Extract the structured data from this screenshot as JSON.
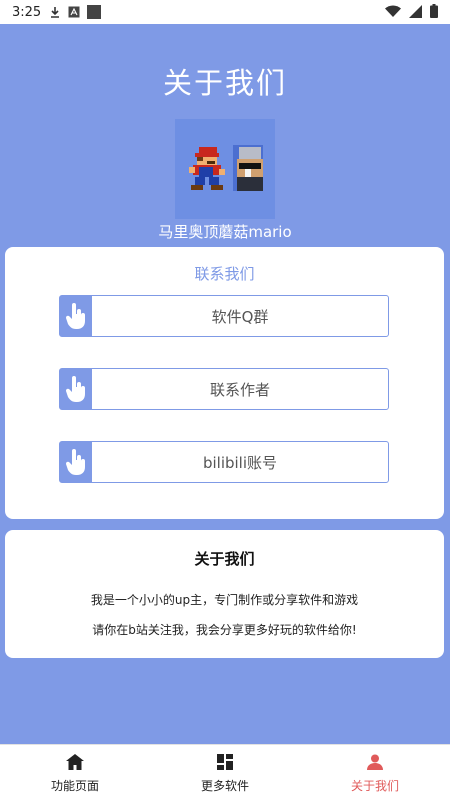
{
  "status_bar": {
    "time": "3:25",
    "icons": [
      "download-icon",
      "a-box-icon",
      "square-icon",
      "wifi-icon",
      "signal-icon",
      "battery-icon"
    ]
  },
  "page": {
    "title": "关于我们",
    "author_name": "马里奥顶蘑菇mario"
  },
  "contact": {
    "heading": "联系我们",
    "buttons": [
      {
        "label": "软件Q群",
        "icon": "hand-pointer-icon"
      },
      {
        "label": "联系作者",
        "icon": "hand-pointer-icon"
      },
      {
        "label": "bilibili账号",
        "icon": "hand-pointer-icon"
      }
    ]
  },
  "about": {
    "heading": "关于我们",
    "lines": [
      "我是一个小小的up主，专门制作或分享软件和游戏",
      "请你在b站关注我，我会分享更多好玩的软件给你!"
    ]
  },
  "bottom_nav": {
    "items": [
      {
        "label": "功能页面",
        "icon": "home-icon"
      },
      {
        "label": "更多软件",
        "icon": "grid-icon"
      },
      {
        "label": "关于我们",
        "icon": "person-icon",
        "active": true
      }
    ]
  },
  "colors": {
    "background": "#7f9ae6",
    "accent": "#7f9ae6",
    "active_nav": "#e05a5a"
  }
}
